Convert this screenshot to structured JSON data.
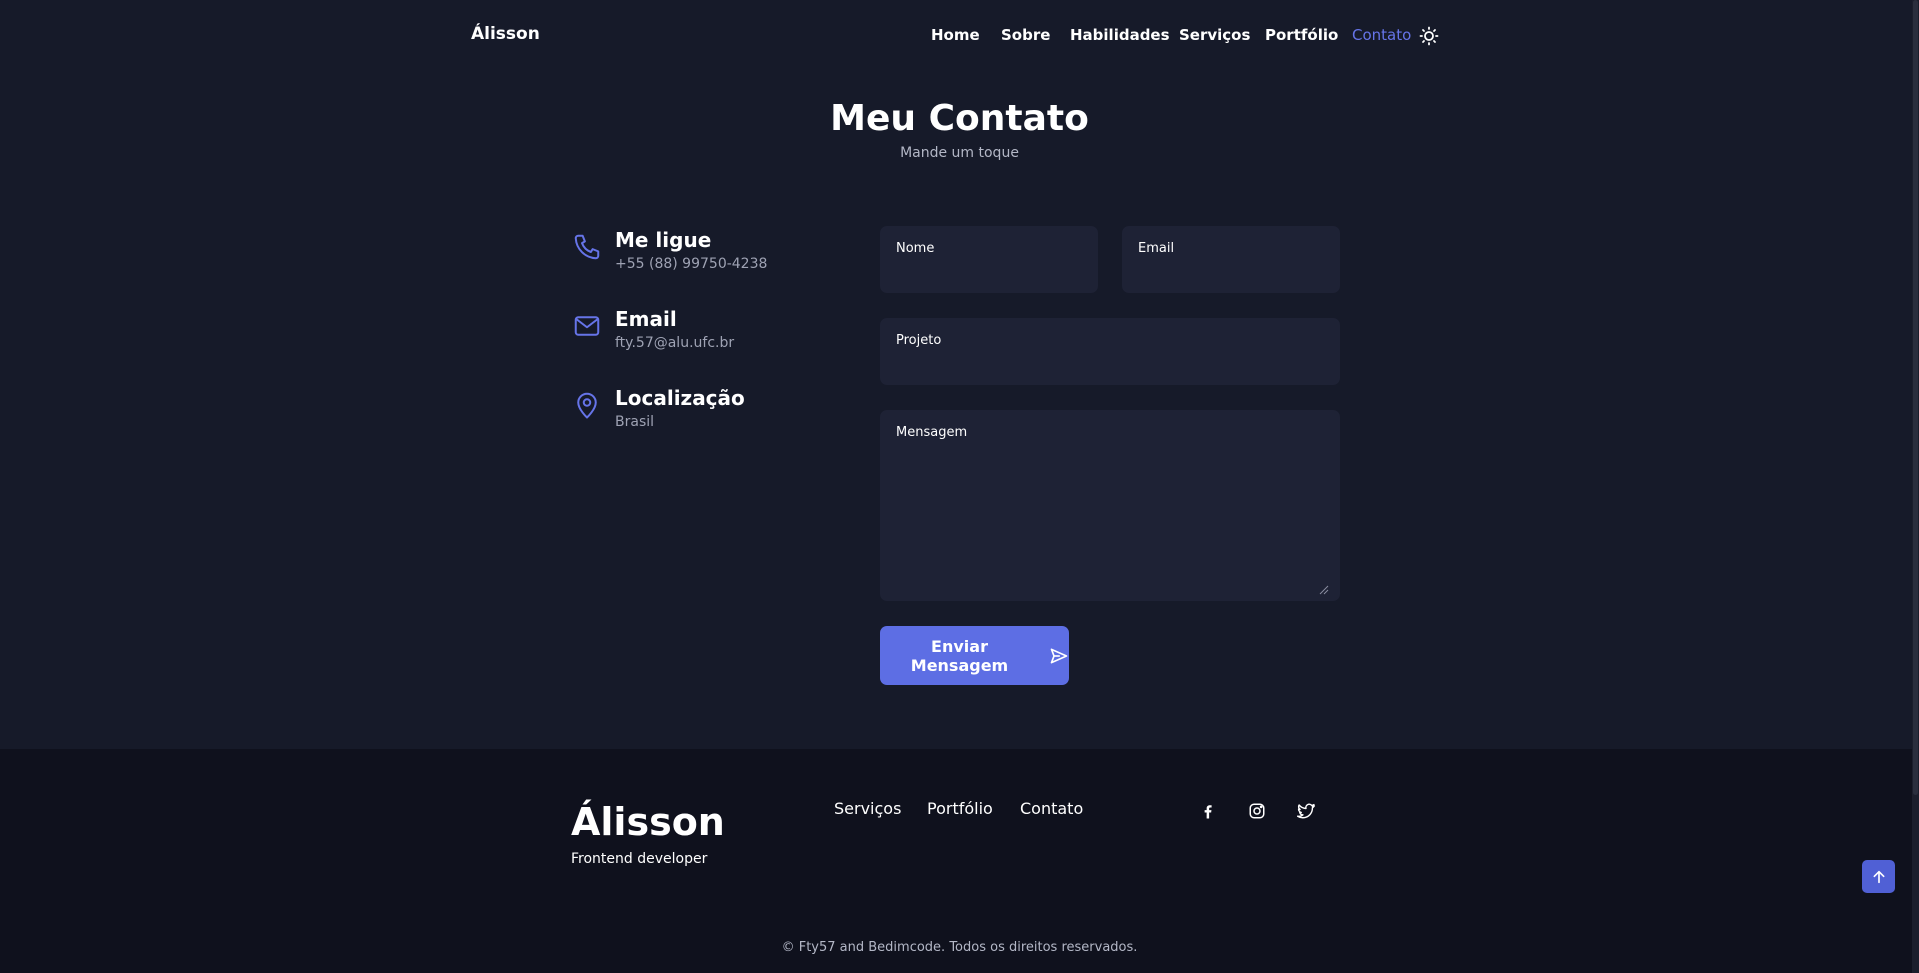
{
  "header": {
    "logo": "Álisson",
    "nav": [
      "Home",
      "Sobre",
      "Habilidades",
      "Serviços",
      "Portfólio",
      "Contato"
    ],
    "active_nav": "Contato",
    "theme_icon": "sun-icon"
  },
  "contact_section": {
    "title": "Meu Contato",
    "subtitle": "Mande um toque",
    "info": [
      {
        "icon": "phone-icon",
        "label": "Me ligue",
        "value": "+55 (88) 99750-4238"
      },
      {
        "icon": "mail-icon",
        "label": "Email",
        "value": "fty.57@alu.ufc.br"
      },
      {
        "icon": "map-pin-icon",
        "label": "Localização",
        "value": "Brasil"
      }
    ]
  },
  "form": {
    "name_label": "Nome",
    "name_value": "",
    "email_label": "Email",
    "email_value": "",
    "project_label": "Projeto",
    "project_value": "",
    "message_label": "Mensagem",
    "message_value": "",
    "submit_label": "Enviar Mensagem",
    "submit_icon": "send-icon"
  },
  "footer": {
    "logo": "Álisson",
    "role": "Frontend developer",
    "links": [
      "Serviços",
      "Portfólio",
      "Contato"
    ],
    "social_icons": [
      "facebook-icon",
      "instagram-icon",
      "twitter-icon"
    ],
    "copyright": "© Fty57 and Bedimcode. Todos os direitos reservados.",
    "scroll_top_icon": "arrow-up-icon"
  },
  "colors": {
    "background": "#161a29",
    "footer_background": "#0f111d",
    "accent": "#5d6ee4",
    "field_background": "#1e2235"
  }
}
